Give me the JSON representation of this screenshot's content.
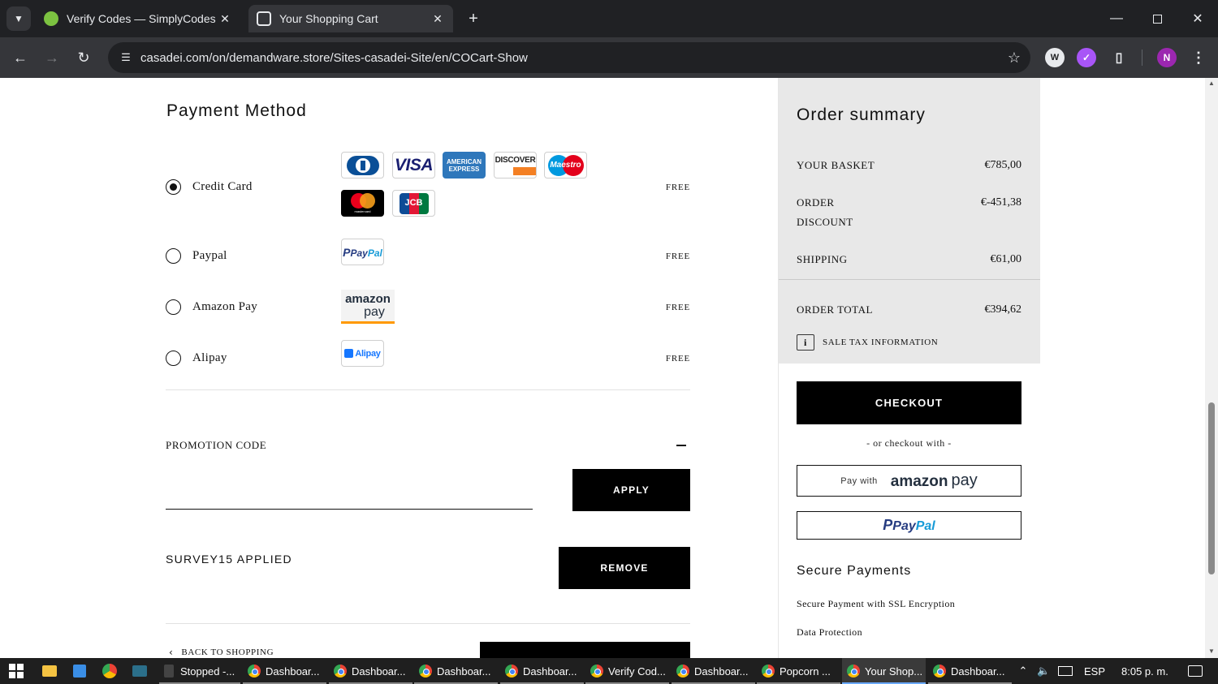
{
  "browser": {
    "tabs": [
      {
        "title": "Verify Codes — SimplyCodes",
        "active": false
      },
      {
        "title": "Your Shopping Cart",
        "active": true
      }
    ],
    "url": "casadei.com/on/demandware.store/Sites-casadei-Site/en/COCart-Show",
    "profile_initial": "N"
  },
  "payment": {
    "title": "Payment Method",
    "methods": [
      {
        "label": "Credit Card",
        "fee": "FREE",
        "selected": true
      },
      {
        "label": "Paypal",
        "fee": "FREE",
        "selected": false
      },
      {
        "label": "Amazon Pay",
        "fee": "FREE",
        "selected": false
      },
      {
        "label": "Alipay",
        "fee": "FREE",
        "selected": false
      }
    ],
    "card_logos": [
      "VISA",
      "AMERICAN EXPRESS",
      "DISCOVER",
      "Maestro",
      "mastercard",
      "JCB"
    ],
    "paypal_logo_p": "P",
    "paypal_logo_pay": "Pay",
    "paypal_logo_pal": "Pal",
    "amazon_logo_top": "amazon",
    "amazon_logo_bottom": "pay",
    "alipay_logo": "Alipay"
  },
  "promo": {
    "label": "PROMOTION CODE",
    "input_value": "",
    "apply_label": "APPLY",
    "applied_text": "SURVEY15 APPLIED",
    "remove_label": "REMOVE"
  },
  "back_to_shopping": "BACK TO SHOPPING",
  "summary": {
    "title": "Order summary",
    "basket_label": "YOUR BASKET",
    "basket_value": "€785,00",
    "discount_label_1": "ORDER",
    "discount_label_2": "DISCOUNT",
    "discount_value": "€-451,38",
    "shipping_label": "SHIPPING",
    "shipping_value": "€61,00",
    "total_label": "ORDER TOTAL",
    "total_value": "€394,62",
    "tax_info": "SALE TAX INFORMATION",
    "checkout_label": "CHECKOUT",
    "or_checkout_with": "- or checkout with -",
    "amazon_pay_with": "Pay with",
    "amazon_word": "amazon",
    "amazon_pay_word": "pay",
    "paypal_p": "P",
    "paypal_pay": "Pay",
    "paypal_pal": "Pal",
    "secure_title": "Secure Payments",
    "secure_lines": [
      "Secure Payment with SSL Encryption",
      "Data Protection"
    ]
  },
  "taskbar": {
    "tasks": [
      "Stopped -...",
      "Dashboar...",
      "Dashboar...",
      "Dashboar...",
      "Dashboar...",
      "Verify Cod...",
      "Dashboar...",
      "Popcorn ...",
      "Your Shop...",
      "Dashboar..."
    ],
    "language": "ESP",
    "time": "8:05 p. m."
  },
  "colors": {
    "chrome_dark": "#202124",
    "chrome_toolbar": "#35363a",
    "summary_grey": "#e8e8e8",
    "button_black": "#000000",
    "paypal_dark": "#253b80",
    "paypal_light": "#179bd7",
    "amazon_orange": "#ff9900"
  }
}
